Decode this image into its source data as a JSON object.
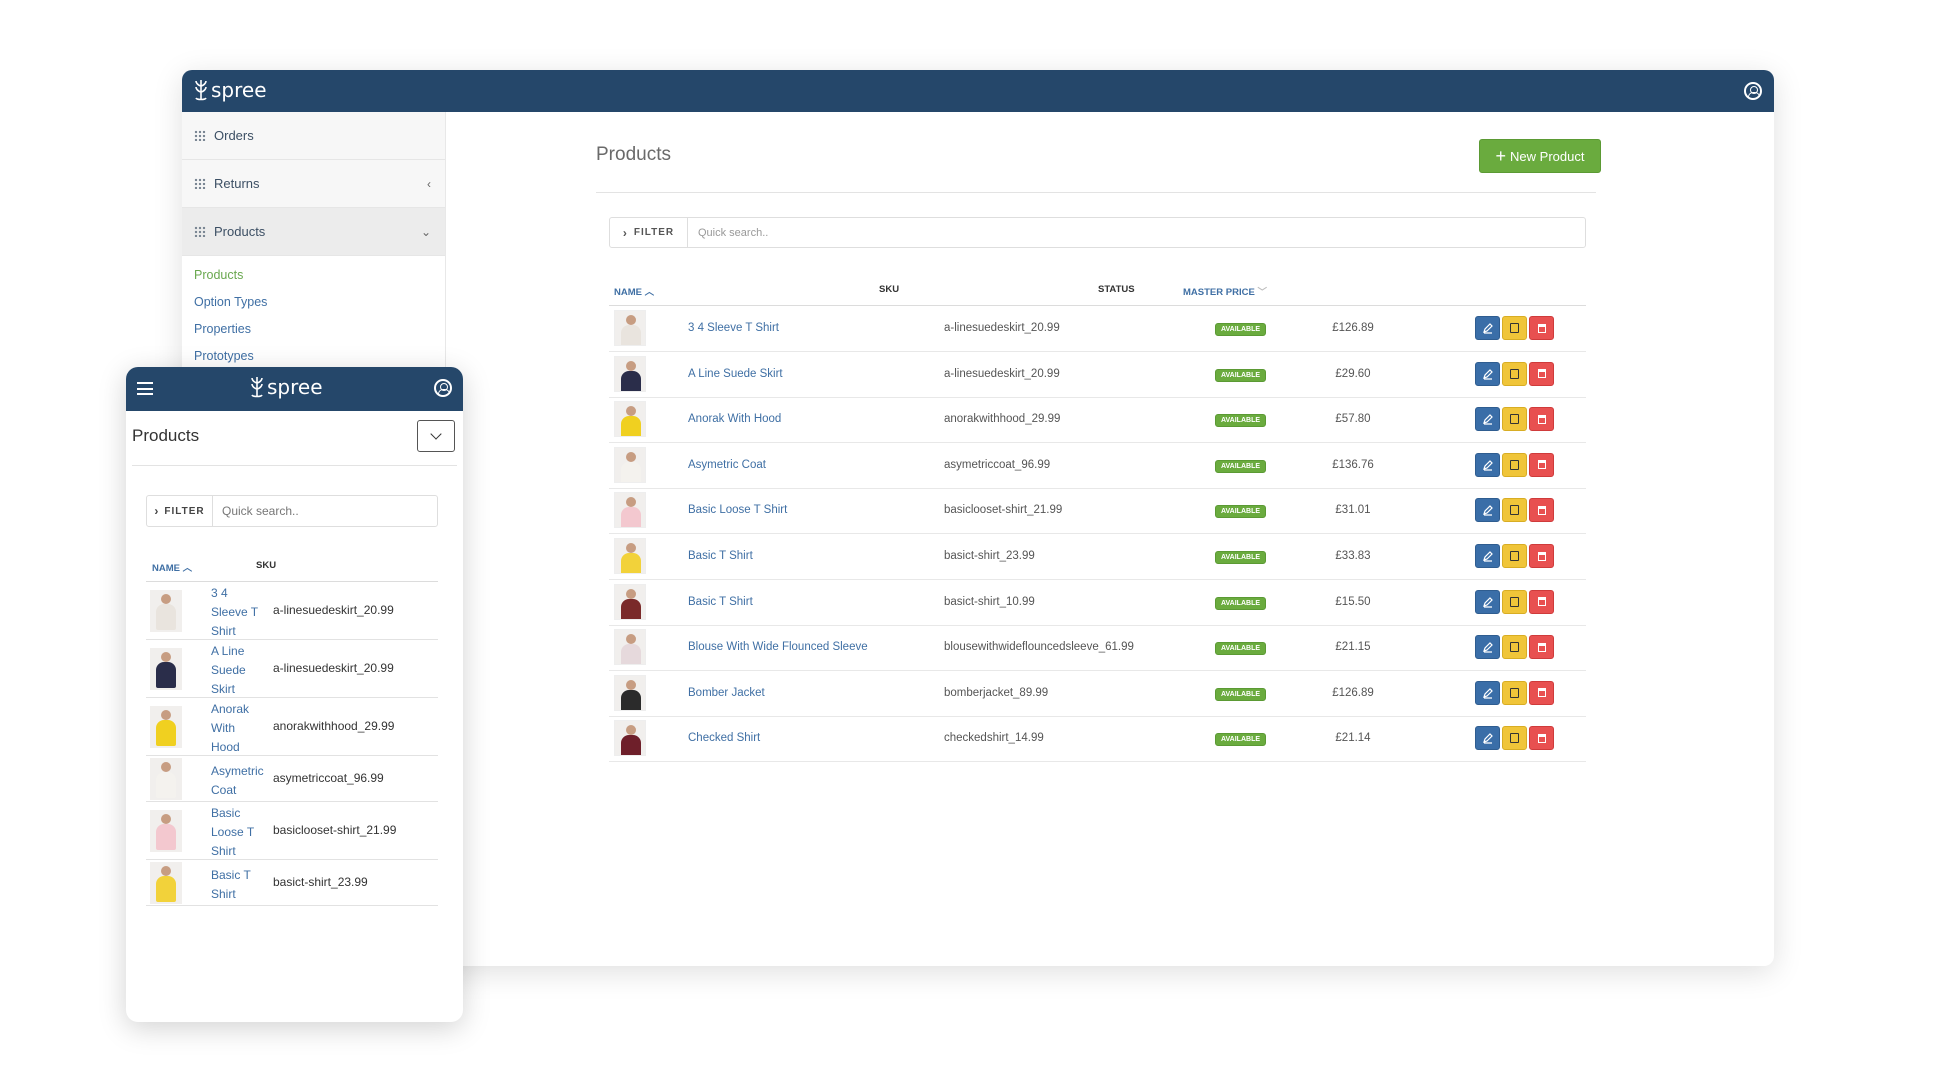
{
  "desktop": {
    "brand": "spree",
    "sidebar": {
      "items": [
        {
          "label": "Orders",
          "icon": "grid-icon"
        },
        {
          "label": "Returns",
          "icon": "grid-icon",
          "chevron": "‹"
        },
        {
          "label": "Products",
          "icon": "grid-icon",
          "chevron": "⌄"
        }
      ],
      "subitems": [
        "Products",
        "Option Types",
        "Properties",
        "Prototypes"
      ]
    },
    "page_title": "Products",
    "new_button": "New Product",
    "filter_label": "FILTER",
    "search_placeholder": "Quick search..",
    "columns": {
      "name": "NAME",
      "sku": "SKU",
      "status": "STATUS",
      "price": "MASTER PRICE"
    },
    "rows": [
      {
        "name": "3 4 Sleeve T Shirt",
        "sku": "a-linesuedeskirt_20.99",
        "status": "AVAILABLE",
        "price": "£126.89",
        "shirt": "#e9e4de"
      },
      {
        "name": "A Line Suede Skirt",
        "sku": "a-linesuedeskirt_20.99",
        "status": "AVAILABLE",
        "price": "£29.60",
        "shirt": "#2a2d4a"
      },
      {
        "name": "Anorak With Hood",
        "sku": "anorakwithhood_29.99",
        "status": "AVAILABLE",
        "price": "£57.80",
        "shirt": "#f0d020"
      },
      {
        "name": "Asymetric Coat",
        "sku": "asymetriccoat_96.99",
        "status": "AVAILABLE",
        "price": "£136.76",
        "shirt": "#f4f2ee"
      },
      {
        "name": "Basic Loose T Shirt",
        "sku": "basiclooset-shirt_21.99",
        "status": "AVAILABLE",
        "price": "£31.01",
        "shirt": "#f3c8cf"
      },
      {
        "name": "Basic T Shirt",
        "sku": "basict-shirt_23.99",
        "status": "AVAILABLE",
        "price": "£33.83",
        "shirt": "#f2d23a"
      },
      {
        "name": "Basic T Shirt",
        "sku": "basict-shirt_10.99",
        "status": "AVAILABLE",
        "price": "£15.50",
        "shirt": "#7a2a2a"
      },
      {
        "name": "Blouse With Wide Flounced Sleeve",
        "sku": "blousewithwideflouncedsleeve_61.99",
        "status": "AVAILABLE",
        "price": "£21.15",
        "shirt": "#e6d9dc"
      },
      {
        "name": "Bomber Jacket",
        "sku": "bomberjacket_89.99",
        "status": "AVAILABLE",
        "price": "£126.89",
        "shirt": "#2b2b2b"
      },
      {
        "name": "Checked Shirt",
        "sku": "checkedshirt_14.99",
        "status": "AVAILABLE",
        "price": "£21.14",
        "shirt": "#6e1f2a"
      }
    ]
  },
  "mobile": {
    "brand": "spree",
    "page_title": "Products",
    "filter_label": "FILTER",
    "search_placeholder": "Quick search..",
    "columns": {
      "name": "NAME",
      "sku": "SKU"
    },
    "rows": [
      {
        "name": "3 4 Sleeve T Shirt",
        "sku": "a-linesuedeskirt_20.99",
        "shirt": "#e9e4de"
      },
      {
        "name": "A Line Suede Skirt",
        "sku": "a-linesuedeskirt_20.99",
        "shirt": "#2a2d4a"
      },
      {
        "name": "Anorak With Hood",
        "sku": "anorakwithhood_29.99",
        "shirt": "#f0d020"
      },
      {
        "name": "Asymetric Coat",
        "sku": "asymetriccoat_96.99",
        "shirt": "#f4f2ee"
      },
      {
        "name": "Basic Loose T Shirt",
        "sku": "basiclooset-shirt_21.99",
        "shirt": "#f3c8cf"
      },
      {
        "name": "Basic T Shirt",
        "sku": "basict-shirt_23.99",
        "shirt": "#f2d23a"
      }
    ]
  },
  "colors": {
    "navbar": "#25476a",
    "accent_green": "#6aab3e",
    "link_blue": "#3f6fa4",
    "edit": "#3a6ea8",
    "clone": "#f0c539",
    "delete": "#e85050"
  }
}
